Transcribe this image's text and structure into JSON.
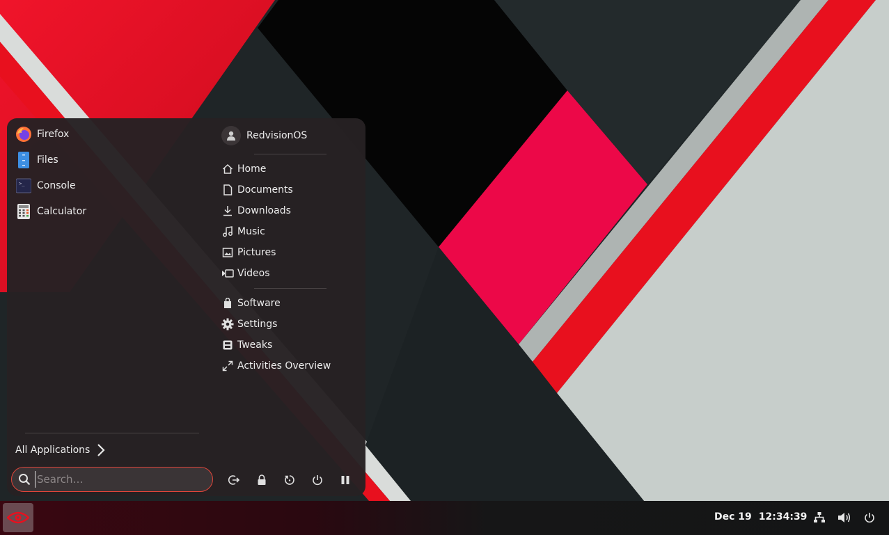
{
  "desktop": {
    "colors": {
      "red": "#e8101e",
      "crimson": "#ec0848",
      "dark": "#1f2527",
      "black": "#000000",
      "light": "#c8cfcc"
    }
  },
  "menu": {
    "pinned_apps": [
      {
        "label": "Firefox",
        "icon": "firefox-icon"
      },
      {
        "label": "Files",
        "icon": "files-icon"
      },
      {
        "label": "Console",
        "icon": "terminal-icon"
      },
      {
        "label": "Calculator",
        "icon": "calculator-icon"
      }
    ],
    "user": {
      "name": "RedvisionOS",
      "icon": "avatar-icon"
    },
    "places": [
      {
        "label": "Home",
        "icon": "home-icon"
      },
      {
        "label": "Documents",
        "icon": "document-icon"
      },
      {
        "label": "Downloads",
        "icon": "download-icon"
      },
      {
        "label": "Music",
        "icon": "music-icon"
      },
      {
        "label": "Pictures",
        "icon": "image-icon"
      },
      {
        "label": "Videos",
        "icon": "video-icon"
      }
    ],
    "system": [
      {
        "label": "Software",
        "icon": "software-bag-icon"
      },
      {
        "label": "Settings",
        "icon": "gear-icon"
      },
      {
        "label": "Tweaks",
        "icon": "tweaks-icon"
      },
      {
        "label": "Activities Overview",
        "icon": "expand-icon"
      }
    ],
    "all_apps_label": "All Applications",
    "search": {
      "placeholder": "Search…",
      "value": ""
    },
    "power_actions": [
      {
        "name": "log-out",
        "icon": "logout-icon"
      },
      {
        "name": "lock",
        "icon": "lock-icon"
      },
      {
        "name": "restart",
        "icon": "restart-icon"
      },
      {
        "name": "power-off",
        "icon": "power-icon"
      },
      {
        "name": "suspend",
        "icon": "pause-icon"
      }
    ]
  },
  "taskbar": {
    "menu_icon": "eye-icon",
    "date": "Dec 19",
    "time": "12:34:39",
    "tray": [
      "network-icon",
      "volume-icon",
      "power-icon"
    ]
  }
}
